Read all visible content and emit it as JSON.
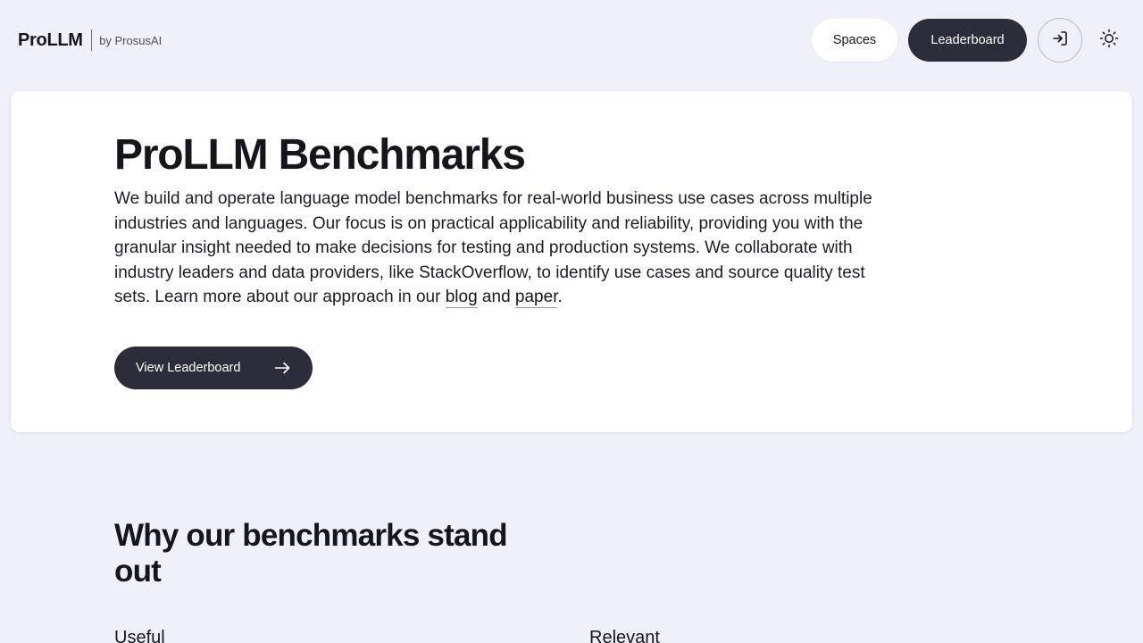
{
  "header": {
    "logo_name": "ProLLM",
    "logo_by": "by ProsusAI",
    "nav": {
      "spaces_label": "Spaces",
      "leaderboard_label": "Leaderboard",
      "login_icon": "login-icon",
      "theme_icon": "sun-icon"
    }
  },
  "hero": {
    "title": "ProLLM Benchmarks",
    "description_start": "We build and operate language model benchmarks for real-world business use cases across multiple industries and languages. Our focus is on practical applicability and reliability, providing you with the granular insight needed to make decisions for testing and production systems. We collaborate with industry leaders and data providers, like StackOverflow, to identify use cases and source quality test sets. Learn more about our approach in our ",
    "blog_link": "blog",
    "and_text": " and ",
    "paper_link": "paper",
    "period": ".",
    "cta_label": "View Leaderboard",
    "cta_icon": "arrow-right-icon"
  },
  "why": {
    "title": "Why our benchmarks stand out",
    "features": [
      {
        "label": "Useful"
      },
      {
        "label": "Relevant"
      }
    ]
  },
  "colors": {
    "page_bg": "#f0f0fa",
    "card_bg": "#ffffff",
    "dark_button": "#2b2d3a",
    "text": "#15161c"
  }
}
